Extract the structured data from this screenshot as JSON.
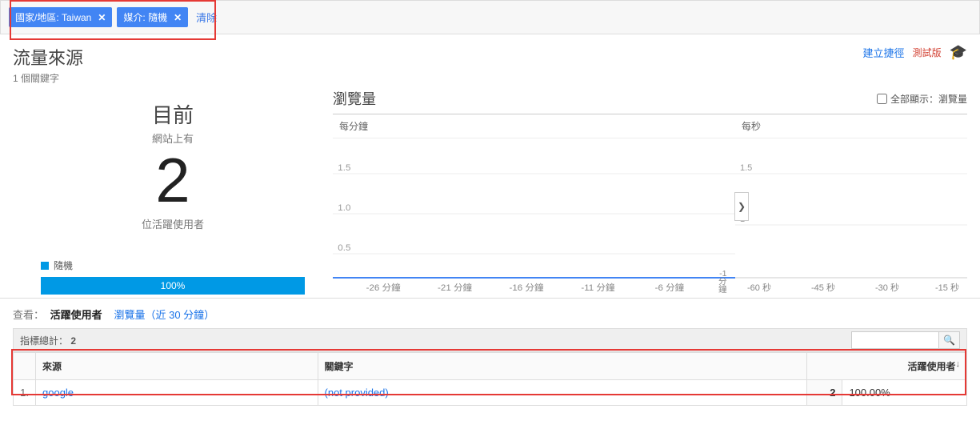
{
  "filters": {
    "chip1": "國家/地區: Taiwan",
    "chip2": "媒介: 隨機",
    "clear": "清除"
  },
  "header": {
    "title": "流量來源",
    "subtitle": "1 個關鍵字",
    "shortcut": "建立捷徑",
    "beta": "測試版"
  },
  "realtime": {
    "now_label": "目前",
    "site_has": "網站上有",
    "count": "2",
    "active_users": "位活躍使用者",
    "legend_item": "隨機",
    "percent": "100%"
  },
  "pageviews": {
    "title": "瀏覽量",
    "show_all_label": "全部顯示：瀏覽量",
    "per_minute": "每分鐘",
    "per_second": "每秒"
  },
  "chart_data": [
    {
      "type": "bar",
      "title": "每分鐘",
      "ylim": [
        0,
        1.5
      ],
      "ticks_y": [
        "1.5",
        "1.0",
        "0.5"
      ],
      "categories": [
        "-26 分鐘",
        "-21 分鐘",
        "-16 分鐘",
        "-11 分鐘",
        "-6 分鐘"
      ],
      "axis_right_label": "-1 分鐘",
      "values": []
    },
    {
      "type": "bar",
      "title": "每秒",
      "ylim": [
        0,
        1.5
      ],
      "ticks_y": [
        "1.5",
        "1"
      ],
      "categories": [
        "-60 秒",
        "-45 秒",
        "-30 秒",
        "-15 秒"
      ],
      "values": []
    }
  ],
  "view_row": {
    "label": "查看：",
    "active_users": "活躍使用者",
    "pageviews_link": "瀏覽量（近 30 分鐘）"
  },
  "metric_bar": {
    "label": "指標總計：",
    "value": "2"
  },
  "table": {
    "col_num": "",
    "col_source": "來源",
    "col_keyword": "關鍵字",
    "col_active": "活躍使用者",
    "rows": [
      {
        "n": "1.",
        "source": "google",
        "keyword": "(not provided)",
        "users": "2",
        "pct": "100.00%"
      }
    ]
  }
}
